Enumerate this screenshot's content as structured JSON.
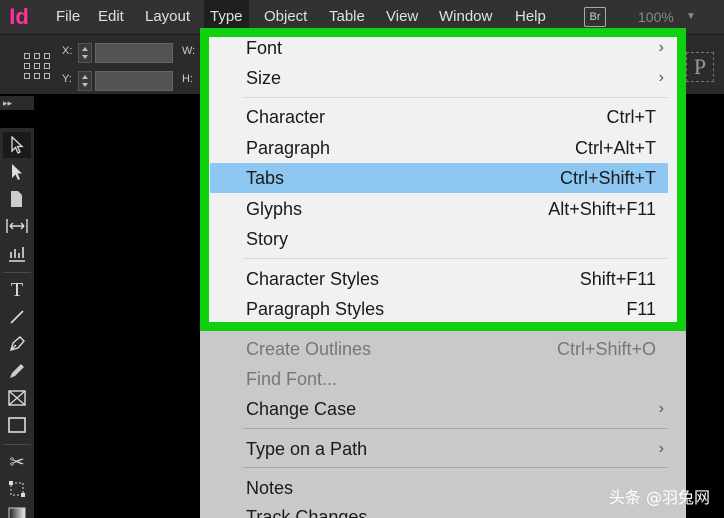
{
  "app": {
    "logo": "Id"
  },
  "menubar": {
    "items": [
      "File",
      "Edit",
      "Layout",
      "Type",
      "Object",
      "Table",
      "View",
      "Window",
      "Help"
    ],
    "bridge_badge": "Br",
    "zoom": "100%"
  },
  "control": {
    "x_label": "X:",
    "y_label": "Y:",
    "w_label": "W:",
    "h_label": "H:",
    "proxy_glyph": "P"
  },
  "type_menu": {
    "font": "Font",
    "size": "Size",
    "character": {
      "label": "Character",
      "shortcut": "Ctrl+T"
    },
    "paragraph": {
      "label": "Paragraph",
      "shortcut": "Ctrl+Alt+T"
    },
    "tabs": {
      "label": "Tabs",
      "shortcut": "Ctrl+Shift+T"
    },
    "glyphs": {
      "label": "Glyphs",
      "shortcut": "Alt+Shift+F11"
    },
    "story": "Story",
    "character_styles": {
      "label": "Character Styles",
      "shortcut": "Shift+F11"
    },
    "paragraph_styles": {
      "label": "Paragraph Styles",
      "shortcut": "F11"
    },
    "create_outlines": {
      "label": "Create Outlines",
      "shortcut": "Ctrl+Shift+O"
    },
    "find_font": "Find Font...",
    "change_case": "Change Case",
    "type_on_path": "Type on a Path",
    "notes": "Notes",
    "track_changes": "Track Changes"
  },
  "watermark": "头条 @羽兔网",
  "colors": {
    "highlight_border": "#0fd10f",
    "selected_row": "#8ec7f2",
    "app_accent": "#ff3399"
  }
}
